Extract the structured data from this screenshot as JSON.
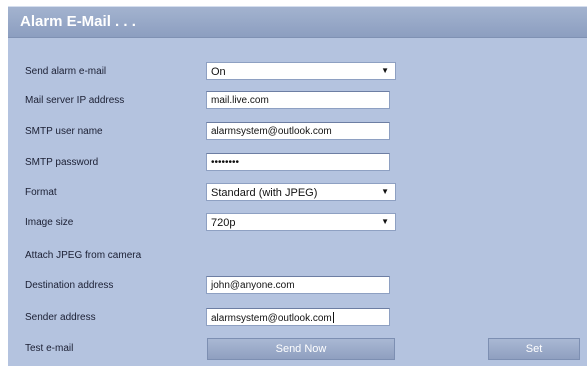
{
  "panel": {
    "title": "Alarm E-Mail . . ."
  },
  "fields": {
    "send_alarm": {
      "label": "Send alarm e-mail",
      "value": "On"
    },
    "mail_server": {
      "label": "Mail server IP address",
      "value": "mail.live.com"
    },
    "smtp_user": {
      "label": "SMTP user name",
      "value": "alarmsystem@outlook.com"
    },
    "smtp_password": {
      "label": "SMTP password",
      "value": "••••••••"
    },
    "format": {
      "label": "Format",
      "value": "Standard (with JPEG)"
    },
    "image_size": {
      "label": "Image size",
      "value": "720p"
    },
    "attach_jpeg": {
      "label": "Attach JPEG from camera"
    },
    "destination": {
      "label": "Destination address",
      "value": "john@anyone.com"
    },
    "sender": {
      "label": "Sender address",
      "value": "alarmsystem@outlook.com"
    },
    "test_email": {
      "label": "Test e-mail"
    }
  },
  "buttons": {
    "send_now": "Send Now",
    "set": "Set"
  },
  "icons": {
    "dropdown": "chevron-down-icon",
    "dropdown_glyph": "▼"
  },
  "colors": {
    "panel_bg": "#b4c3df",
    "title_bar": "#8c9ec0",
    "button": "#9aaaca"
  }
}
